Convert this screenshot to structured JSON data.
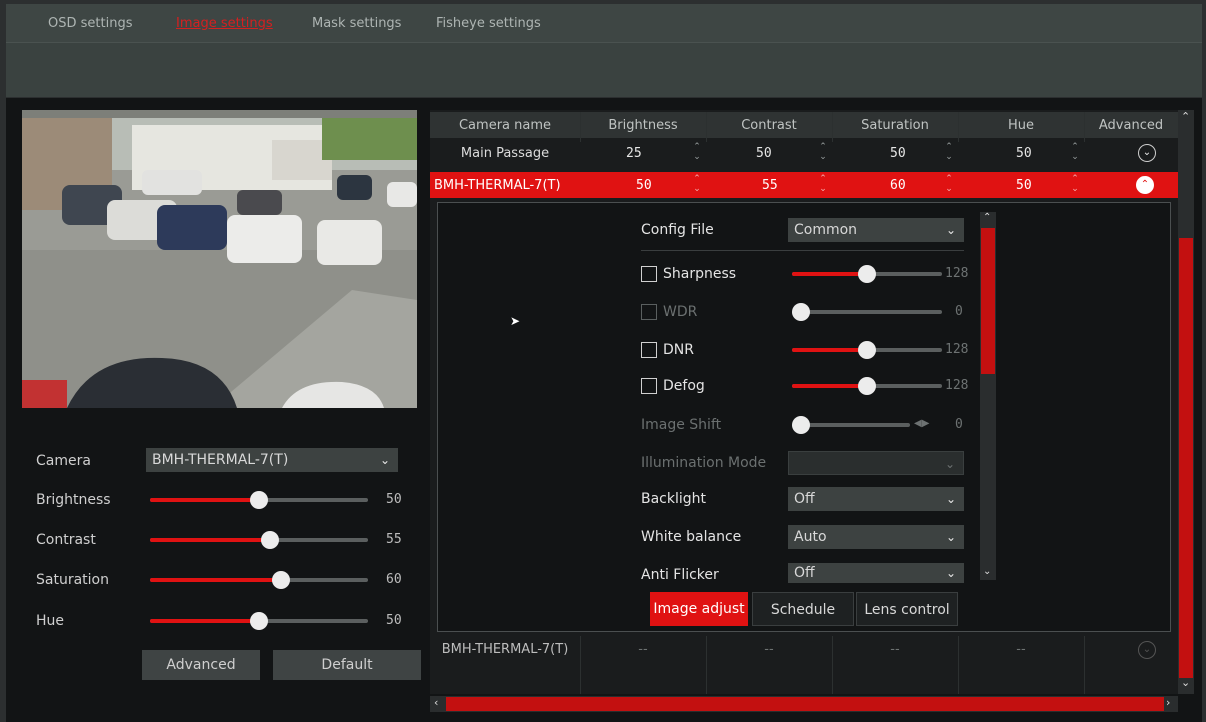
{
  "tabs": [
    "OSD settings",
    "Image settings",
    "Mask settings",
    "Fisheye settings"
  ],
  "left": {
    "camera_label": "Camera",
    "camera_value": "BMH-THERMAL-7(T)",
    "sliders": [
      {
        "label": "Brightness",
        "value": "50",
        "level": 0.5
      },
      {
        "label": "Contrast",
        "value": "55",
        "level": 0.55
      },
      {
        "label": "Saturation",
        "value": "60",
        "level": 0.6
      },
      {
        "label": "Hue",
        "value": "50",
        "level": 0.5
      }
    ],
    "advanced_btn": "Advanced",
    "default_btn": "Default"
  },
  "table": {
    "headers": [
      "Camera name",
      "Brightness",
      "Contrast",
      "Saturation",
      "Hue",
      "Advanced"
    ],
    "rows": [
      {
        "name": "Main Passage",
        "values": [
          "25",
          "50",
          "50",
          "50"
        ]
      },
      {
        "name": "BMH-THERMAL-7(T)",
        "values": [
          "50",
          "55",
          "60",
          "50"
        ]
      },
      {
        "name": "BMH-THERMAL-7(T)",
        "values": [
          "--",
          "--",
          "--",
          "--"
        ]
      }
    ]
  },
  "advanced": {
    "config_file_label": "Config File",
    "config_file_value": "Common",
    "sharpness_label": "Sharpness",
    "sharpness_value": "128",
    "sharpness_level": 0.5,
    "wdr_label": "WDR",
    "wdr_value": "0",
    "wdr_level": 0.0,
    "dnr_label": "DNR",
    "dnr_value": "128",
    "dnr_level": 0.5,
    "defog_label": "Defog",
    "defog_value": "128",
    "defog_level": 0.5,
    "image_shift_label": "Image Shift",
    "image_shift_value": "0",
    "image_shift_level": 0.0,
    "illumination_label": "Illumination Mode",
    "backlight_label": "Backlight",
    "backlight_value": "Off",
    "white_balance_label": "White balance",
    "white_balance_value": "Auto",
    "anti_flicker_label": "Anti Flicker",
    "anti_flicker_value": "Off",
    "tab_image_adjust": "Image adjust",
    "tab_schedule": "Schedule",
    "tab_lens_control": "Lens control"
  },
  "colors": {
    "accent": "#e01212",
    "active_tab": "#d42020"
  }
}
